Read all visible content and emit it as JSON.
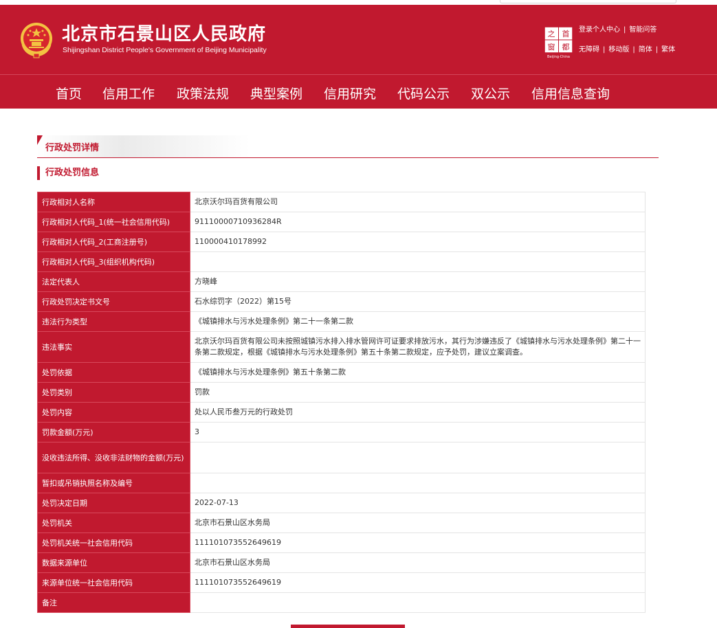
{
  "header": {
    "title_cn": "北京市石景山区人民政府",
    "title_en": "Shijingshan District People's Government of Beijing Municipality",
    "links_row1": [
      "登录个人中心",
      "智能问答"
    ],
    "links_row2": [
      "无障碍",
      "移动版",
      "简体",
      "繁体"
    ],
    "seal_chars": [
      "之",
      "首",
      "窗",
      "都"
    ],
    "seal_sub": "Beijing·China"
  },
  "nav": {
    "items": [
      "首页",
      "信用工作",
      "政策法规",
      "典型案例",
      "信用研究",
      "代码公示",
      "双公示",
      "信用信息查询"
    ]
  },
  "section": {
    "title": "行政处罚详情",
    "subtitle": "行政处罚信息"
  },
  "rows": [
    {
      "label": "行政相对人名称",
      "value": "北京沃尔玛百货有限公司"
    },
    {
      "label": "行政相对人代码_1(统一社会信用代码)",
      "value": "91110000710936284R"
    },
    {
      "label": "行政相对人代码_2(工商注册号)",
      "value": "110000410178992"
    },
    {
      "label": "行政相对人代码_3(组织机构代码)",
      "value": ""
    },
    {
      "label": "法定代表人",
      "value": "方晓峰"
    },
    {
      "label": "行政处罚决定书文号",
      "value": "石水综罚字（2022）第15号"
    },
    {
      "label": "违法行为类型",
      "value": "《城镇排水与污水处理条例》第二十一条第二款"
    },
    {
      "label": "违法事实",
      "value": "北京沃尔玛百货有限公司未按照城镇污水排入排水管网许可证要求排放污水，其行为涉嫌违反了《城镇排水与污水处理条例》第二十一条第二款规定，根据《城镇排水与污水处理条例》第五十条第二款规定，应予处罚，建议立案调查。"
    },
    {
      "label": "处罚依据",
      "value": "《城镇排水与污水处理条例》第五十条第二款"
    },
    {
      "label": "处罚类别",
      "value": "罚款"
    },
    {
      "label": "处罚内容",
      "value": "处以人民币叁万元的行政处罚"
    },
    {
      "label": "罚款金额(万元)",
      "value": "3"
    },
    {
      "label": "没收违法所得、没收非法财物的金额(万元)",
      "value": ""
    },
    {
      "label": "暂扣或吊销执照名称及编号",
      "value": ""
    },
    {
      "label": "处罚决定日期",
      "value": "2022-07-13"
    },
    {
      "label": "处罚机关",
      "value": "北京市石景山区水务局"
    },
    {
      "label": "处罚机关统一社会信用代码",
      "value": "11110107355264961​9"
    },
    {
      "label": "数据来源单位",
      "value": "北京市石景山区水务局"
    },
    {
      "label": "来源单位统一社会信用代码",
      "value": "111101073552649619"
    },
    {
      "label": "备注",
      "value": ""
    }
  ],
  "colors": {
    "brand_red": "#c1192f",
    "gold": "#f3c342"
  }
}
